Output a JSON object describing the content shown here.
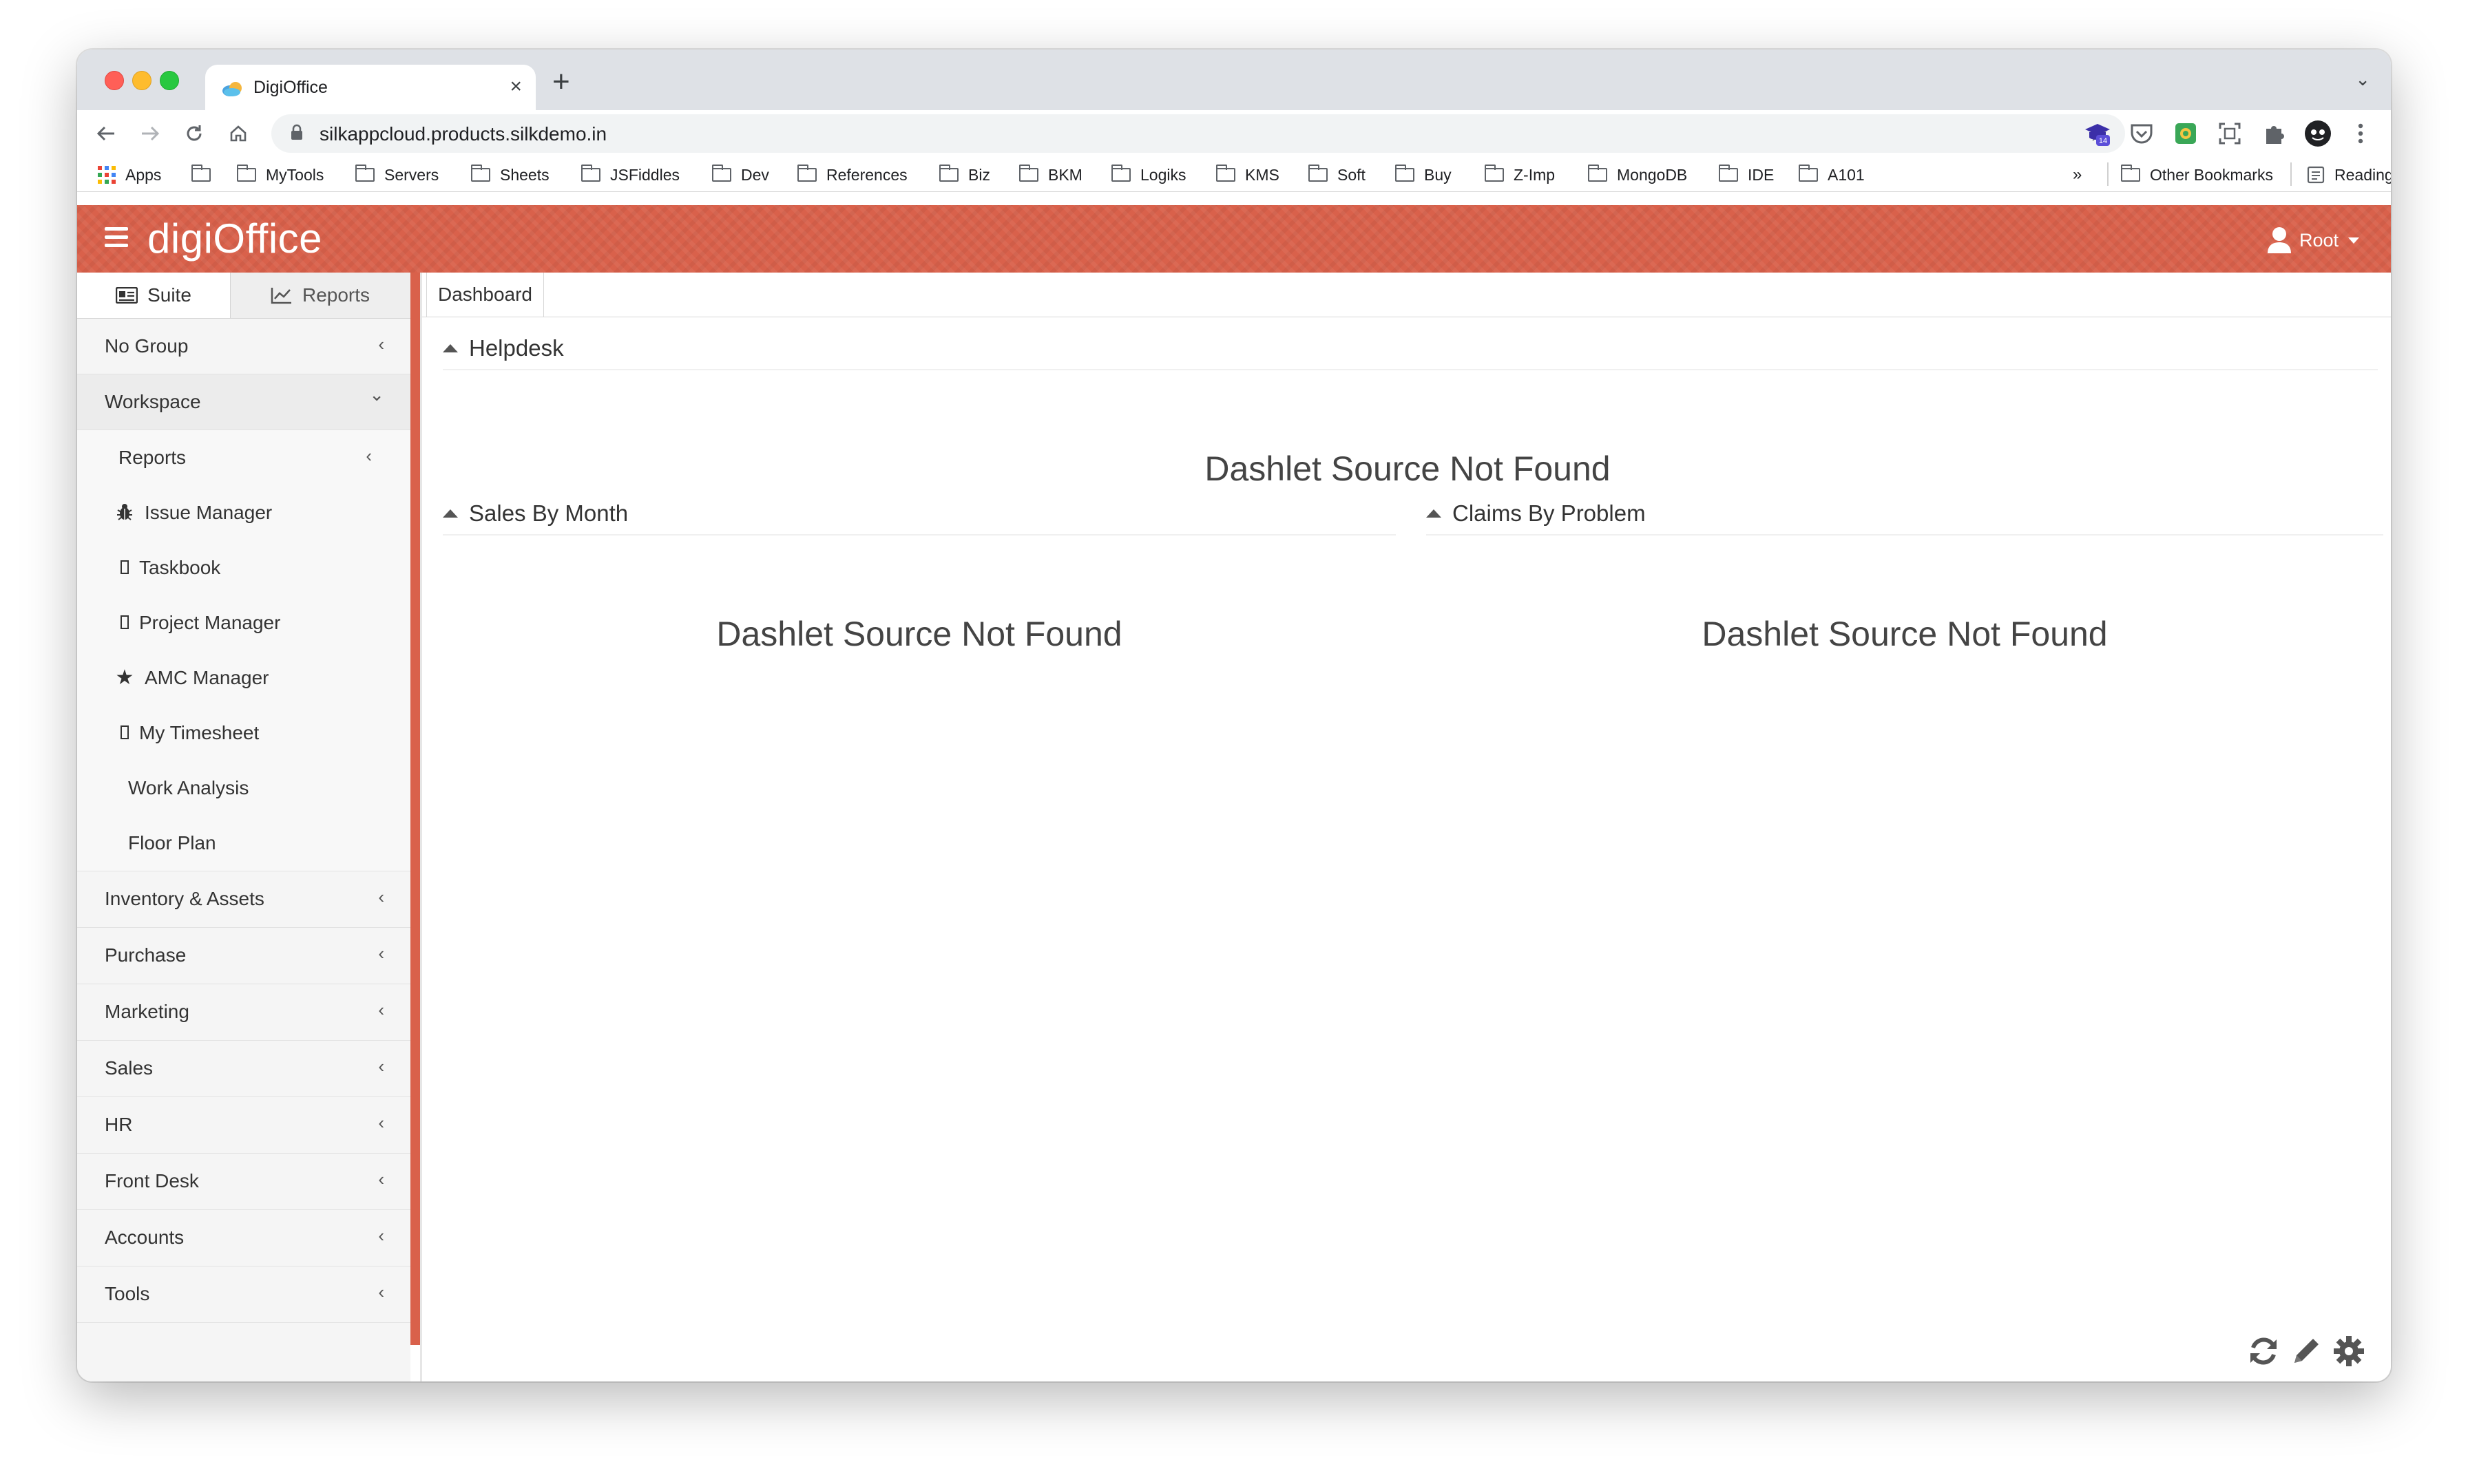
{
  "browser": {
    "tab_title": "DigiOffice",
    "tab_close": "×",
    "new_tab": "+",
    "url": "silkappcloud.products.silkdemo.in",
    "extension_badge": "14"
  },
  "bookmarks": {
    "apps_label": "Apps",
    "items": [
      "MyTools",
      "Servers",
      "Sheets",
      "JSFiddles",
      "Dev",
      "References",
      "Biz",
      "BKM",
      "Logiks",
      "KMS",
      "Soft",
      "Buy",
      "Z-Imp",
      "MongoDB",
      "IDE",
      "A101"
    ],
    "overflow": "»",
    "other": "Other Bookmarks",
    "reading_list": "Reading List"
  },
  "app": {
    "brand": "digiOffice",
    "user": "Root",
    "accent_color": "#d9614b"
  },
  "sidebar": {
    "tabs": [
      {
        "label": "Suite",
        "icon": "id-card-icon",
        "active": true
      },
      {
        "label": "Reports",
        "icon": "line-chart-icon",
        "active": false
      }
    ],
    "groups_top": [
      {
        "label": "No Group",
        "chevron": "‹"
      },
      {
        "label": "Workspace",
        "chevron": "⌄"
      }
    ],
    "workspace_items": [
      {
        "label": "Reports",
        "icon": "",
        "chevron": "‹"
      },
      {
        "label": "Issue Manager",
        "icon": "bug-icon"
      },
      {
        "label": "Taskbook",
        "icon": "square-icon"
      },
      {
        "label": "Project Manager",
        "icon": "square-icon"
      },
      {
        "label": "AMC Manager",
        "icon": "star-icon"
      },
      {
        "label": "My Timesheet",
        "icon": "square-icon"
      },
      {
        "label": "Work Analysis",
        "icon": ""
      },
      {
        "label": "Floor Plan",
        "icon": ""
      }
    ],
    "groups_bottom": [
      {
        "label": "Inventory & Assets",
        "chevron": "‹"
      },
      {
        "label": "Purchase",
        "chevron": "‹"
      },
      {
        "label": "Marketing",
        "chevron": "‹"
      },
      {
        "label": "Sales",
        "chevron": "‹"
      },
      {
        "label": "HR",
        "chevron": "‹"
      },
      {
        "label": "Front Desk",
        "chevron": "‹"
      },
      {
        "label": "Accounts",
        "chevron": "‹"
      },
      {
        "label": "Tools",
        "chevron": "‹"
      }
    ]
  },
  "main": {
    "tab_label": "Dashboard",
    "dashlets": [
      {
        "title": "Helpdesk",
        "message": "Dashlet Source Not Found"
      },
      {
        "title": "Sales By Month",
        "message": "Dashlet Source Not Found"
      },
      {
        "title": "Claims By Problem",
        "message": "Dashlet Source Not Found"
      }
    ],
    "tool_icons": [
      "refresh-icon",
      "pencil-icon",
      "gear-icon"
    ]
  }
}
